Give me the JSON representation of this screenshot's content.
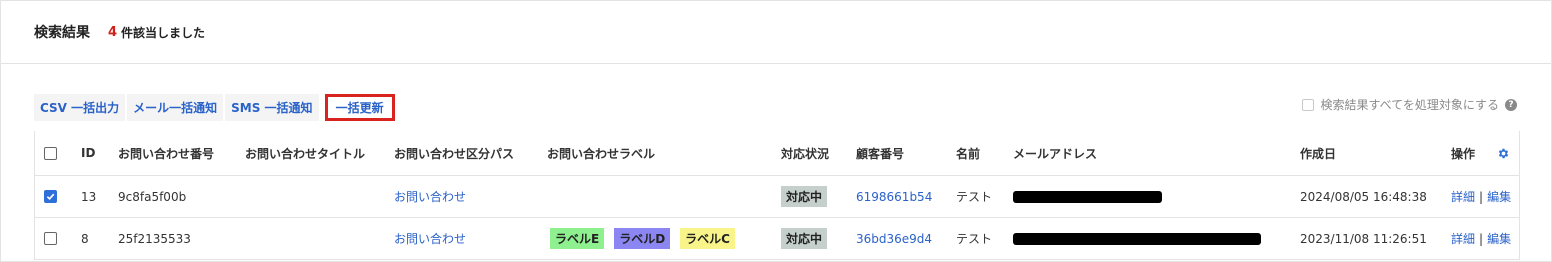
{
  "header": {
    "title": "検索結果",
    "count": "4",
    "count_suffix": "件該当しました"
  },
  "toolbar": {
    "csv": "CSV 一括出力",
    "mail": "メール一括通知",
    "sms": "SMS 一括通知",
    "bulk_update": "一括更新"
  },
  "select_all": {
    "label": "検索結果すべてを処理対象にする",
    "help": "?"
  },
  "columns": {
    "id": "ID",
    "number": "お問い合わせ番号",
    "title": "お問い合わせタイトル",
    "path": "お問い合わせ区分パス",
    "labels": "お問い合わせラベル",
    "status": "対応状況",
    "customer": "顧客番号",
    "name": "名前",
    "email": "メールアドレス",
    "created": "作成日",
    "actions": "操作"
  },
  "rows": [
    {
      "checked": true,
      "id": "13",
      "number": "9c8fa5f00b",
      "title": "",
      "path": "お問い合わせ",
      "labels": [],
      "status": "対応中",
      "customer": "6198661b54",
      "name": "テスト",
      "created": "2024/08/05 16:48:38",
      "detail": "詳細",
      "edit": "編集"
    },
    {
      "checked": false,
      "id": "8",
      "number": "25f2135533",
      "title": "",
      "path": "お問い合わせ",
      "labels": [
        {
          "text": "ラベルE",
          "color": "#8ef08e"
        },
        {
          "text": "ラベルD",
          "color": "#8b86f2"
        },
        {
          "text": "ラベルC",
          "color": "#f8f48a"
        }
      ],
      "status": "対応中",
      "customer": "36bd36e9d4",
      "name": "テスト",
      "created": "2023/11/08 11:26:51",
      "detail": "詳細",
      "edit": "編集"
    }
  ],
  "colors": {
    "accent": "#2a62c9",
    "count": "#d0211c",
    "highlight": "#d9231e"
  },
  "icons": {
    "settings": "gear-icon",
    "help": "help-icon",
    "check": "check-icon"
  }
}
